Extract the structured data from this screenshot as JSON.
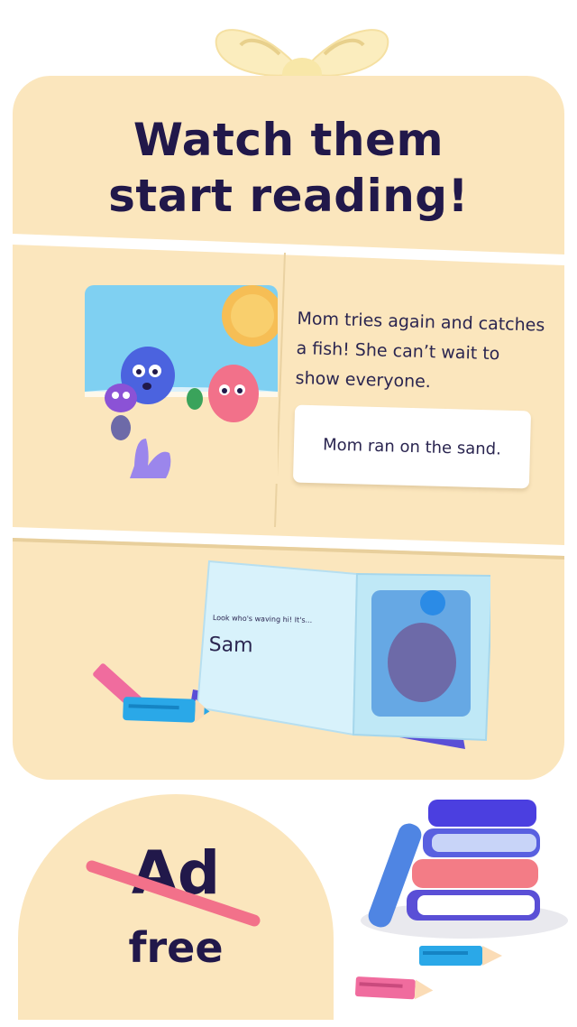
{
  "banner": {
    "headline_line1": "Watch them",
    "headline_line2": "start reading!"
  },
  "story_page": {
    "text": "Mom tries again and catches a fish! She can’t wait to show everyone.",
    "sentence": "Mom ran on the sand."
  },
  "book": {
    "prompt": "Look who's waving hi! It's...",
    "name": "Sam"
  },
  "badge": {
    "crossed_word": "Ad",
    "word": "free"
  },
  "colors": {
    "card": "#fbe6bd",
    "text": "#21184a",
    "accent_pink": "#f2718a",
    "accent_blue": "#4b3fe0",
    "sky": "#7fd0f2",
    "sun": "#f6be55"
  },
  "icons": [
    "bow-icon",
    "sun-icon",
    "monster-icon",
    "pencil-icon",
    "book-icon",
    "books-stack-icon"
  ]
}
